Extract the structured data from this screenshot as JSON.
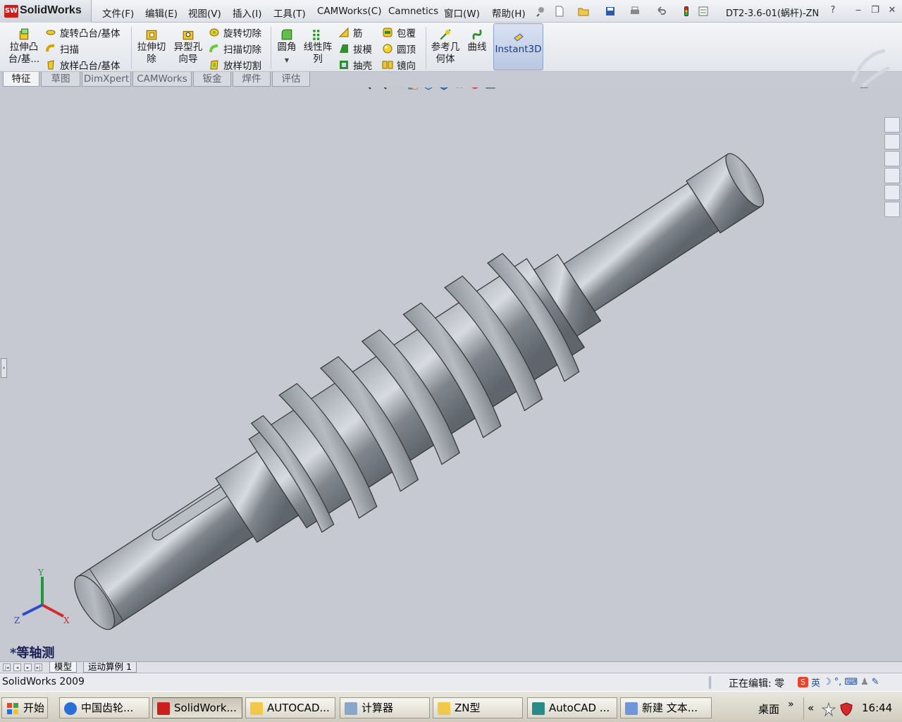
{
  "app": {
    "name": "SolidWorks",
    "version_label": "SolidWorks 2009",
    "logo_text": "SW"
  },
  "menu": [
    "文件(F)",
    "编辑(E)",
    "视图(V)",
    "插入(I)",
    "工具(T)",
    "CAMWorks(C)",
    "Camnetics",
    "窗口(W)",
    "帮助(H)"
  ],
  "document_title": "DT2-3.6-01(蜗杆)-ZN",
  "title_help": "?",
  "commands": {
    "extrude_boss": "拉伸凸台/基...",
    "revolve_boss": "旋转凸台/基体",
    "sweep": "扫描",
    "loft": "放样凸台/基体",
    "extrude_cut": "拉伸切除",
    "hole_wizard": "异型孔向导",
    "revolve_cut": "旋转切除",
    "sweep_cut": "扫描切除",
    "loft_cut": "放样切割",
    "fillet": "圆角",
    "linear_pattern": "线性阵列",
    "rib": "筋",
    "draft": "拔模",
    "shell": "抽壳",
    "wrap": "包覆",
    "dome": "圆顶",
    "mirror": "镜向",
    "ref_geometry": "参考几何体",
    "curves": "曲线",
    "instant3d": "Instant3D"
  },
  "tabs": [
    "特征",
    "草图",
    "DimXpert",
    "CAMWorks",
    "钣金",
    "焊件",
    "评估"
  ],
  "active_tab": "特征",
  "viewport": {
    "view_name": "*等轴测",
    "triad": {
      "x": "X",
      "y": "Y",
      "z": "Z"
    }
  },
  "model_tabs": [
    "模型",
    "运动算例 1"
  ],
  "status": {
    "editing": "正在编辑: 零",
    "ime_lang": "英"
  },
  "taskbar": {
    "start": "开始",
    "items": [
      "中国齿轮...",
      "SolidWork...",
      "AUTOCAD...",
      "计算器",
      "ZN型",
      "AutoCAD ...",
      "新建 文本..."
    ],
    "desktop": "桌面",
    "clock": "16:44"
  },
  "colors": {
    "accent": "#c9201e",
    "viewport_bg": "#c6c9d2",
    "instant3d_active": "#b9c7e2"
  }
}
